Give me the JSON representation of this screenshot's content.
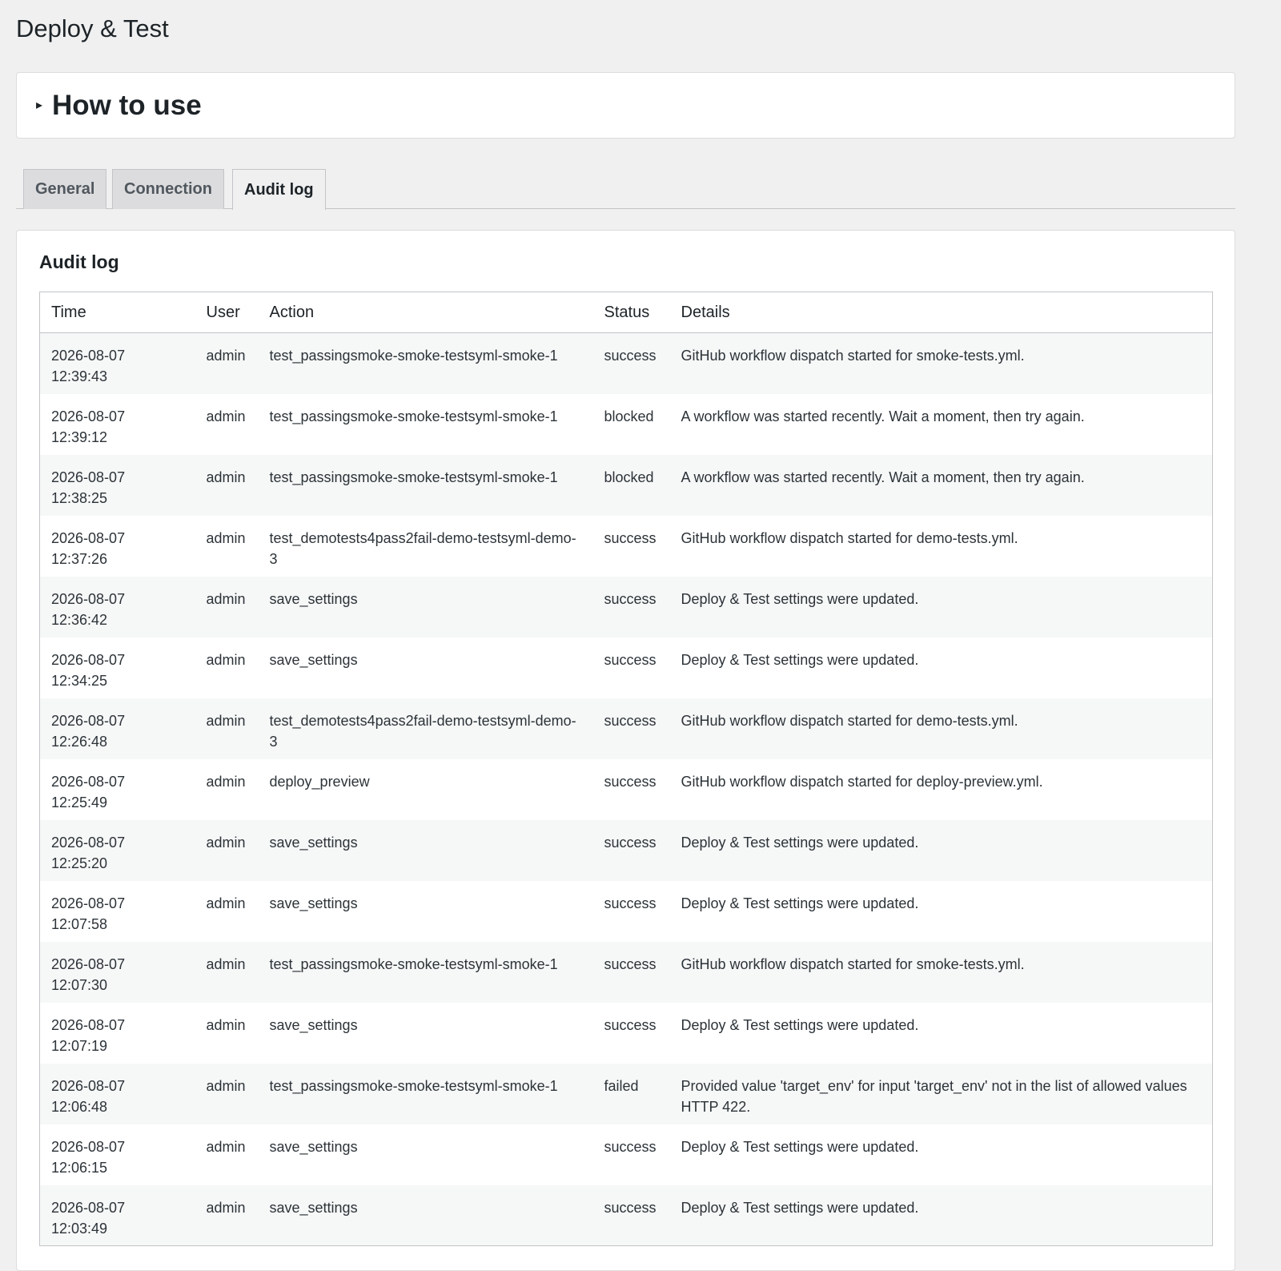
{
  "page": {
    "title": "Deploy & Test"
  },
  "howto": {
    "icon": "triangle-right-icon",
    "title": "How to use"
  },
  "tabs": [
    {
      "label": "General",
      "active": false
    },
    {
      "label": "Connection",
      "active": false
    },
    {
      "label": "Audit log",
      "active": true
    }
  ],
  "audit": {
    "title": "Audit log",
    "columns": [
      "Time",
      "User",
      "Action",
      "Status",
      "Details"
    ],
    "rows": [
      {
        "date": "2026-08-07",
        "time": "12:39:43",
        "user": "admin",
        "action": "test_passingsmoke-smoke-testsyml-smoke-1",
        "status": "success",
        "details": "GitHub workflow dispatch started for smoke-tests.yml."
      },
      {
        "date": "2026-08-07",
        "time": "12:39:12",
        "user": "admin",
        "action": "test_passingsmoke-smoke-testsyml-smoke-1",
        "status": "blocked",
        "details": "A workflow was started recently. Wait a moment, then try again."
      },
      {
        "date": "2026-08-07",
        "time": "12:38:25",
        "user": "admin",
        "action": "test_passingsmoke-smoke-testsyml-smoke-1",
        "status": "blocked",
        "details": "A workflow was started recently. Wait a moment, then try again."
      },
      {
        "date": "2026-08-07",
        "time": "12:37:26",
        "user": "admin",
        "action": "test_demotests4pass2fail-demo-testsyml-demo-3",
        "status": "success",
        "details": "GitHub workflow dispatch started for demo-tests.yml."
      },
      {
        "date": "2026-08-07",
        "time": "12:36:42",
        "user": "admin",
        "action": "save_settings",
        "status": "success",
        "details": "Deploy & Test settings were updated."
      },
      {
        "date": "2026-08-07",
        "time": "12:34:25",
        "user": "admin",
        "action": "save_settings",
        "status": "success",
        "details": "Deploy & Test settings were updated."
      },
      {
        "date": "2026-08-07",
        "time": "12:26:48",
        "user": "admin",
        "action": "test_demotests4pass2fail-demo-testsyml-demo-3",
        "status": "success",
        "details": "GitHub workflow dispatch started for demo-tests.yml."
      },
      {
        "date": "2026-08-07",
        "time": "12:25:49",
        "user": "admin",
        "action": "deploy_preview",
        "status": "success",
        "details": "GitHub workflow dispatch started for deploy-preview.yml."
      },
      {
        "date": "2026-08-07",
        "time": "12:25:20",
        "user": "admin",
        "action": "save_settings",
        "status": "success",
        "details": "Deploy & Test settings were updated."
      },
      {
        "date": "2026-08-07",
        "time": "12:07:58",
        "user": "admin",
        "action": "save_settings",
        "status": "success",
        "details": "Deploy & Test settings were updated."
      },
      {
        "date": "2026-08-07",
        "time": "12:07:30",
        "user": "admin",
        "action": "test_passingsmoke-smoke-testsyml-smoke-1",
        "status": "success",
        "details": "GitHub workflow dispatch started for smoke-tests.yml."
      },
      {
        "date": "2026-08-07",
        "time": "12:07:19",
        "user": "admin",
        "action": "save_settings",
        "status": "success",
        "details": "Deploy & Test settings were updated."
      },
      {
        "date": "2026-08-07",
        "time": "12:06:48",
        "user": "admin",
        "action": "test_passingsmoke-smoke-testsyml-smoke-1",
        "status": "failed",
        "details": "Provided value 'target_env' for input 'target_env' not in the list of allowed values HTTP 422."
      },
      {
        "date": "2026-08-07",
        "time": "12:06:15",
        "user": "admin",
        "action": "save_settings",
        "status": "success",
        "details": "Deploy & Test settings were updated."
      },
      {
        "date": "2026-08-07",
        "time": "12:03:49",
        "user": "admin",
        "action": "save_settings",
        "status": "success",
        "details": "Deploy & Test settings were updated."
      }
    ]
  }
}
